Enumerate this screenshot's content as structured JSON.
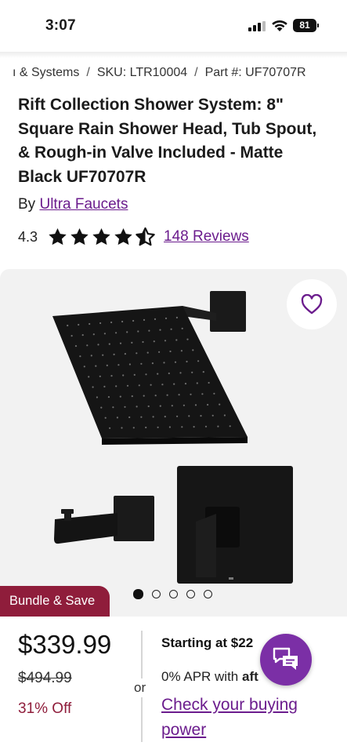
{
  "status_bar": {
    "time": "3:07",
    "battery": "81",
    "icons": [
      "signal-icon",
      "wifi-icon",
      "battery-icon"
    ]
  },
  "breadcrumb": {
    "category": "ı & Systems",
    "sku": "SKU: LTR10004",
    "part": "Part #: UF70707R",
    "separator": "/"
  },
  "product": {
    "title": "Rift Collection Shower System: 8\" Square Rain Shower Head, Tub Spout, & Rough-in Valve Included - Matte Black UF70707R",
    "by_label": "By",
    "brand": "Ultra Faucets",
    "rating": "4.3",
    "rating_value": 4.3,
    "reviews_link": "148 Reviews"
  },
  "gallery": {
    "image_count": 5,
    "active_index": 0,
    "badge": "Bundle & Save",
    "favorite_icon": "heart-icon"
  },
  "pricing": {
    "price": "$339.99",
    "original_price": "$494.99",
    "discount": "31% Off",
    "or_label": "or",
    "financing_start": "Starting at $22",
    "financing_tail": "or",
    "apr_prefix": "0% APR with",
    "apr_brand": "aft",
    "check_link": "Check your buying power"
  },
  "chat": {
    "icon": "chat-icon"
  },
  "colors": {
    "brand_purple": "#6b1c8d",
    "badge_red": "#8f1d3b",
    "chat_purple": "#7b2fa6",
    "gallery_bg": "#f2f2f2"
  }
}
